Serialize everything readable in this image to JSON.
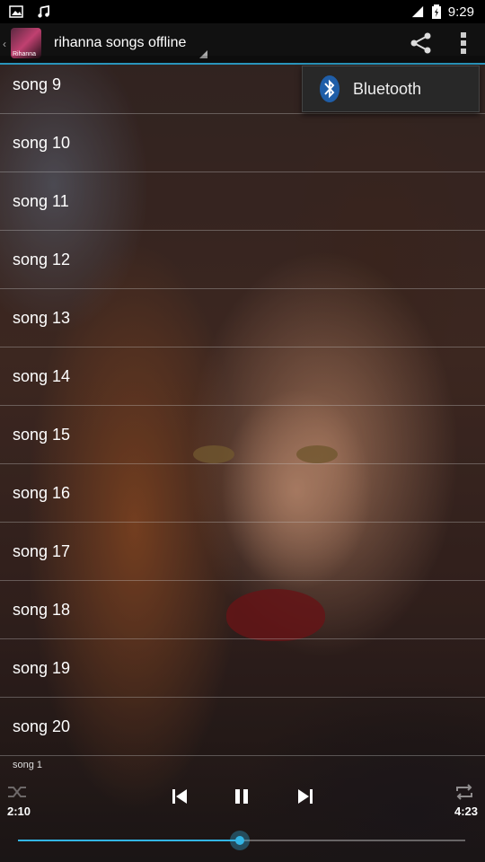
{
  "status_bar": {
    "time": "9:29",
    "left_icons": [
      "image-icon",
      "music-note-icon"
    ],
    "right_icons": [
      "signal-icon",
      "battery-icon"
    ]
  },
  "action_bar": {
    "app_icon_text": "Rihanna",
    "title": "rihanna songs offline",
    "actions": [
      "share-icon",
      "overflow-menu-icon"
    ]
  },
  "popup_menu": {
    "items": [
      {
        "label": "Bluetooth",
        "icon": "bluetooth-icon"
      }
    ]
  },
  "songs": [
    "song 9",
    "song 10",
    "song 11",
    "song 12",
    "song 13",
    "song 14",
    "song 15",
    "song 16",
    "song 17",
    "song 18",
    "song 19",
    "song 20"
  ],
  "player": {
    "now_playing": "song 1",
    "current_time": "2:10",
    "total_time": "4:23",
    "progress_fraction": 0.496,
    "accent_color": "#33b5e5",
    "controls": [
      "shuffle-icon",
      "previous-icon",
      "pause-icon",
      "next-icon",
      "repeat-icon"
    ]
  }
}
